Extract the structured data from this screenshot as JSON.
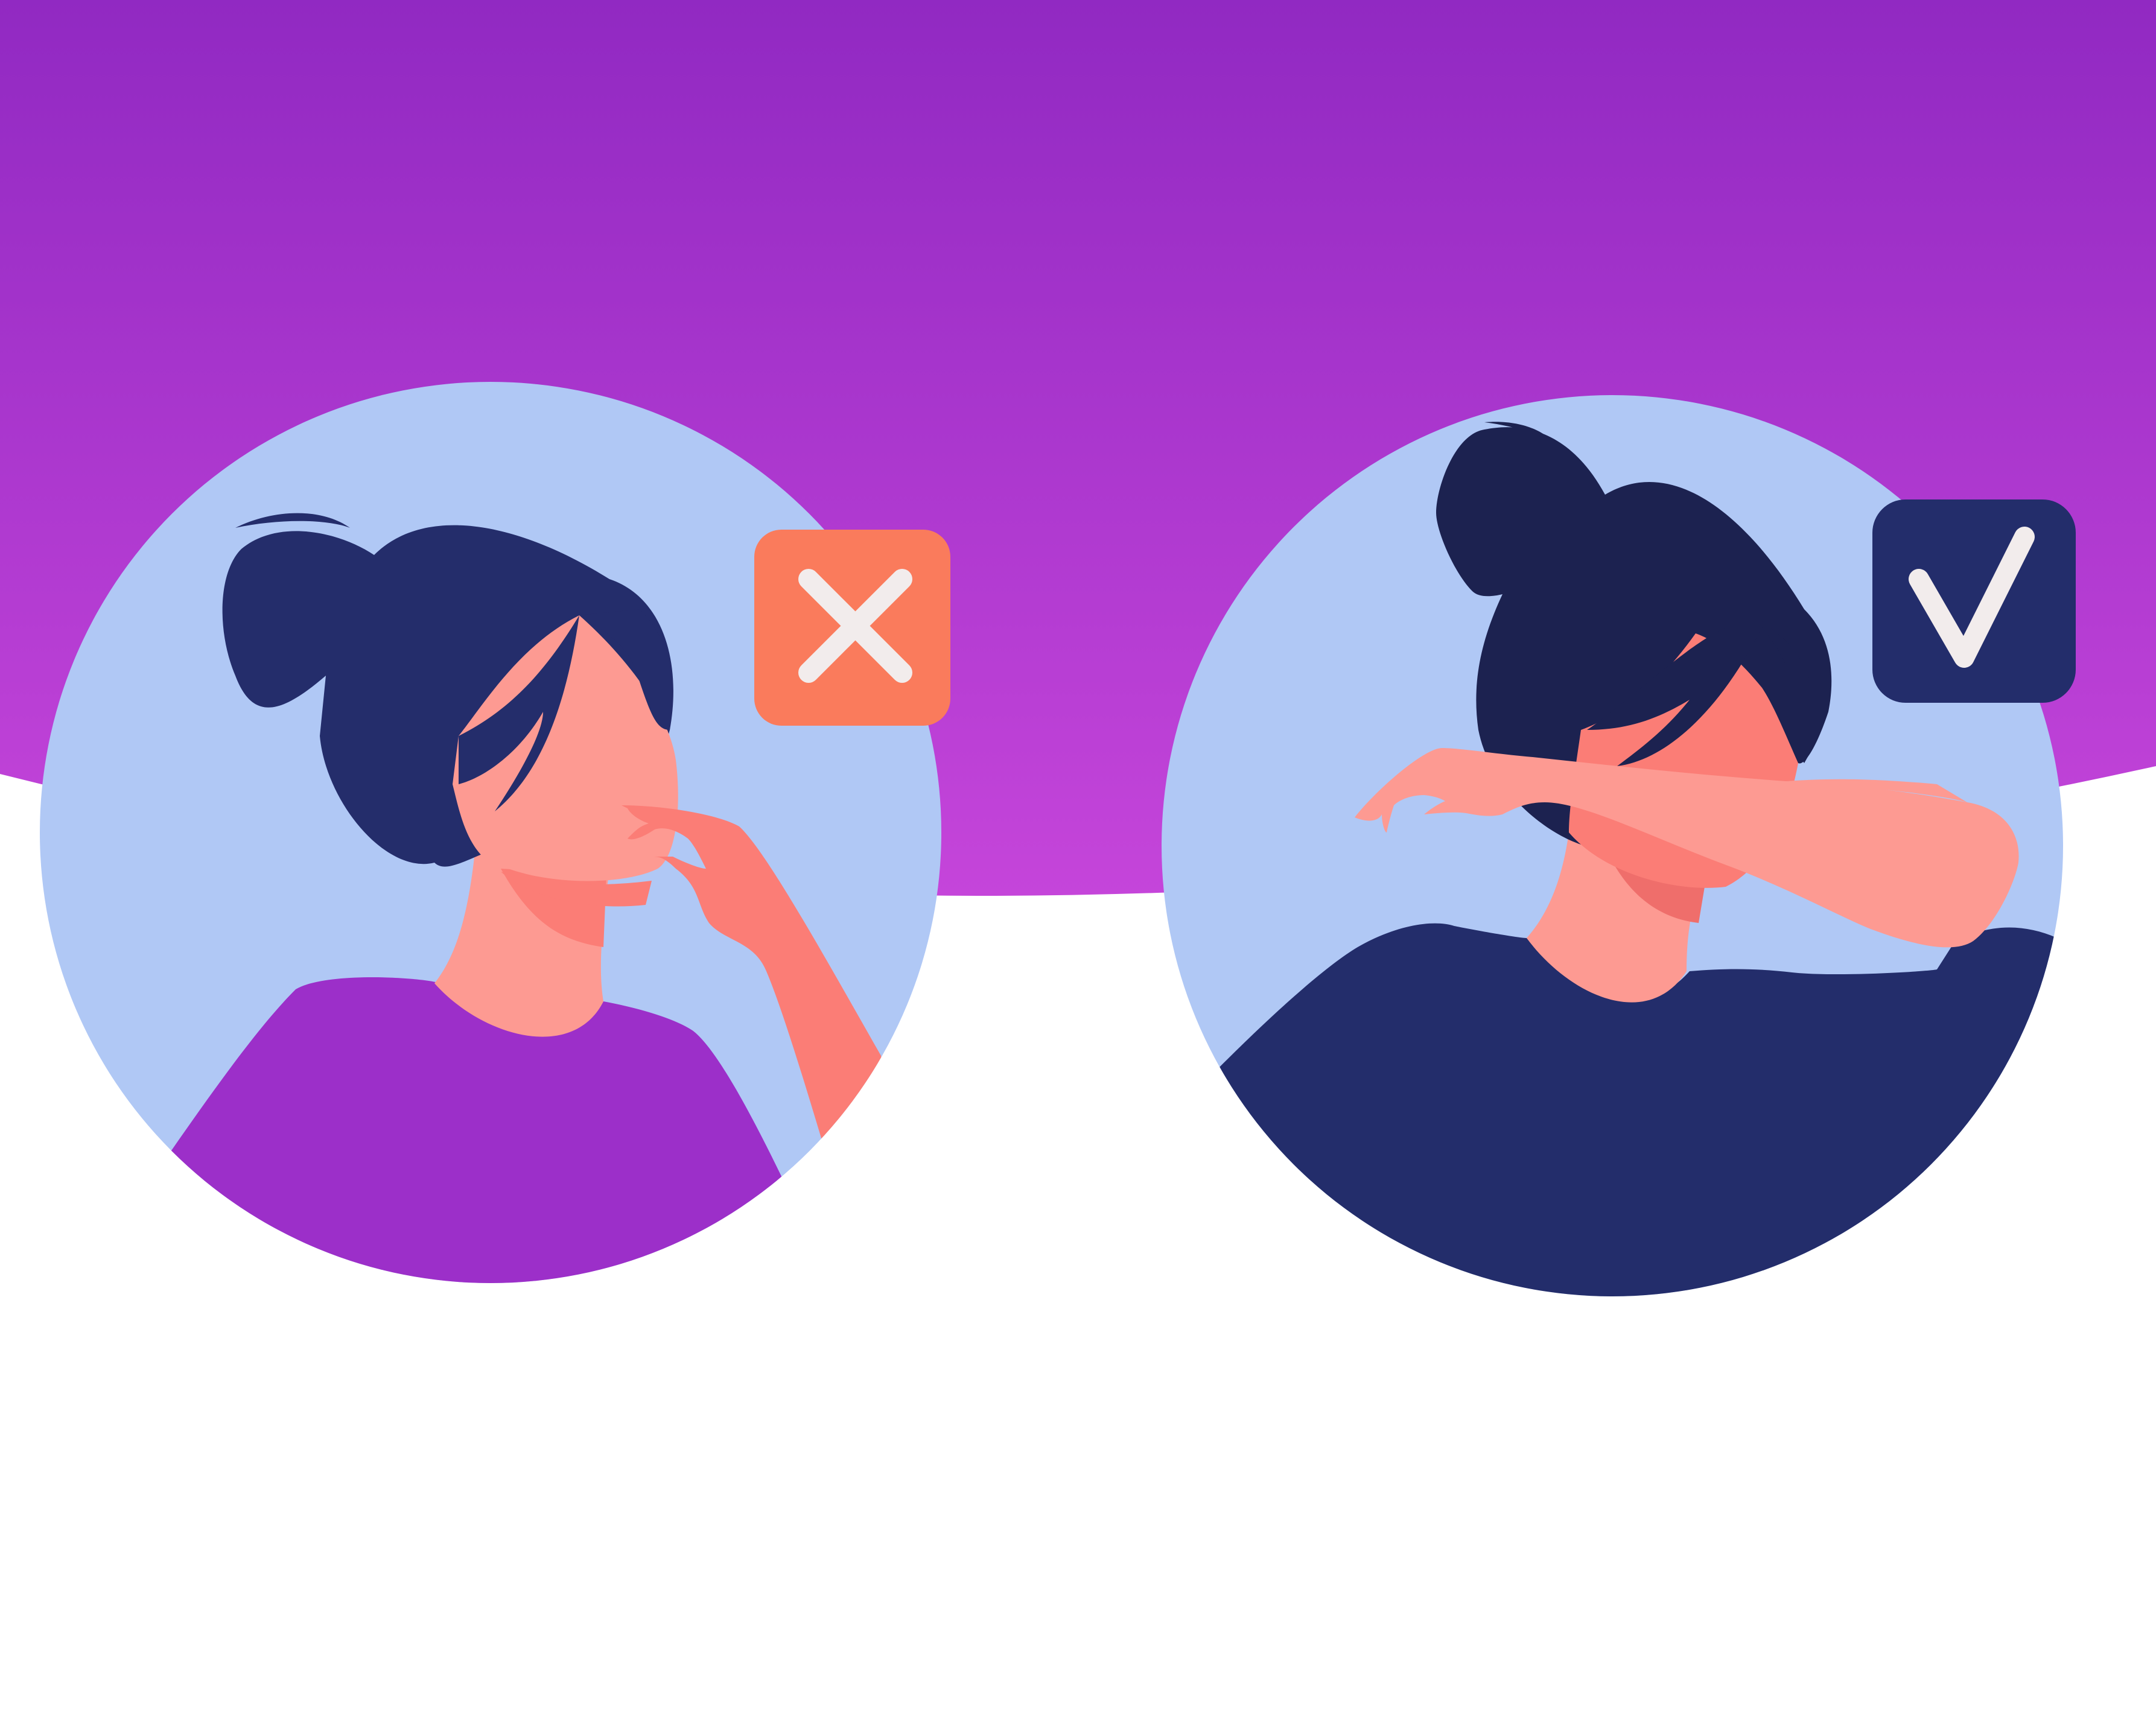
{
  "colors": {
    "page_background": "#ffffff",
    "banner_gradient_top": "#9129c2",
    "banner_gradient_bottom": "#c545da",
    "circle_background": "#b0c8f5",
    "hair_left": "#242d6b",
    "hair_right": "#1c2250",
    "skin": "#fd9a92",
    "skin_shadow": "#fb7d76",
    "skin_deep_shadow": "#ef6e6b",
    "shirt_left": "#9c2fc9",
    "shirt_right": "#232d6b",
    "incorrect_badge": "#fa7b5c",
    "correct_badge": "#232d6b",
    "badge_glyph": "#f2ecec"
  },
  "panels": [
    {
      "id": "incorrect",
      "description": "cough-into-hand",
      "badge_icon": "cross-icon"
    },
    {
      "id": "correct",
      "description": "cough-into-elbow",
      "badge_icon": "check-icon"
    }
  ]
}
